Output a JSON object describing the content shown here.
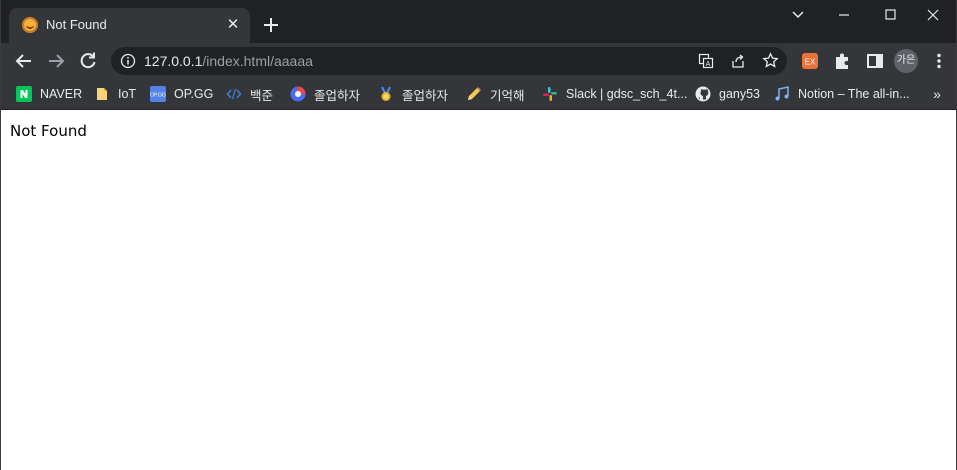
{
  "tab": {
    "title": "Not Found",
    "close_glyph": "✕"
  },
  "omnibox": {
    "url_host": "127.0.0.1",
    "url_path": "/index.html/aaaaa"
  },
  "profile": {
    "label": "가은"
  },
  "bookmarks": [
    {
      "label": "NAVER",
      "icon": "naver-icon"
    },
    {
      "label": "IoT",
      "icon": "folder-icon"
    },
    {
      "label": "OP.GG",
      "icon": "opgg-icon"
    },
    {
      "label": "백준",
      "icon": "code-brackets-icon"
    },
    {
      "label": "졸업하자",
      "icon": "app-circle-icon"
    },
    {
      "label": "졸업하자",
      "icon": "medal-icon"
    },
    {
      "label": "기억해",
      "icon": "pencil-icon"
    },
    {
      "label": "Slack | gdsc_sch_4t...",
      "icon": "slack-icon"
    },
    {
      "label": "gany53",
      "icon": "github-icon"
    },
    {
      "label": "Notion – The all-in...",
      "icon": "music-notes-icon"
    }
  ],
  "bookmarks_more": "»",
  "page": {
    "message": "Not Found"
  },
  "colors": {
    "tabstrip": "#202124",
    "toolbar": "#35363a",
    "text": "#e8eaed"
  }
}
